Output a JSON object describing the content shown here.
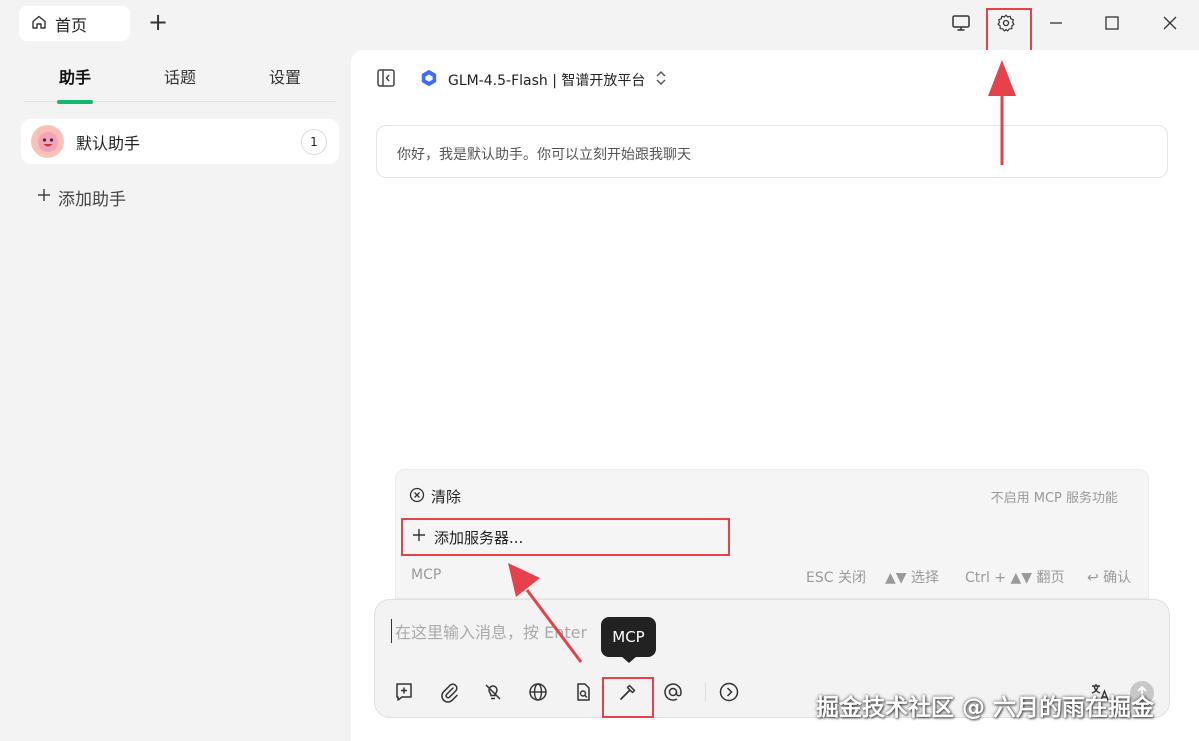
{
  "titlebar": {
    "home_tab_label": "首页",
    "new_tab_symbol": "+",
    "icons": [
      "home-icon",
      "monitor-icon",
      "settings-gear-icon",
      "minimize-icon",
      "maximize-icon",
      "close-icon"
    ]
  },
  "sidebar": {
    "tabs": [
      {
        "label": "助手",
        "active": true
      },
      {
        "label": "话题",
        "active": false
      },
      {
        "label": "设置",
        "active": false
      }
    ],
    "assistants": [
      {
        "name": "默认助手",
        "count": "1"
      }
    ],
    "add_assistant_label": "添加助手",
    "accent_color": "#14b86b"
  },
  "chat": {
    "model_name": "GLM-4.5-Flash | 智谱开放平台",
    "greeting": "你好，我是默认助手。你可以立刻开始跟我聊天"
  },
  "mcp_popup": {
    "clear_label": "清除",
    "status_text": "不启用 MCP 服务功能",
    "add_server_label": "添加服务器...",
    "footer_label": "MCP",
    "hints": [
      "ESC 关闭",
      "▲▼ 选择",
      "Ctrl + ▲▼ 翻页",
      "↩ 确认"
    ]
  },
  "input": {
    "placeholder": "在这里输入消息，按 Enter",
    "tooltip": "MCP",
    "tools": [
      "new-topic-icon",
      "attachment-icon",
      "thinking-off-icon",
      "web-search-icon",
      "knowledge-icon",
      "mcp-hammer-icon",
      "mention-icon",
      "expand-icon",
      "translate-icon",
      "send-icon"
    ]
  },
  "watermark": "掘金技术社区 @ 六月的雨在掘金",
  "annotation_color": "#e6424b"
}
